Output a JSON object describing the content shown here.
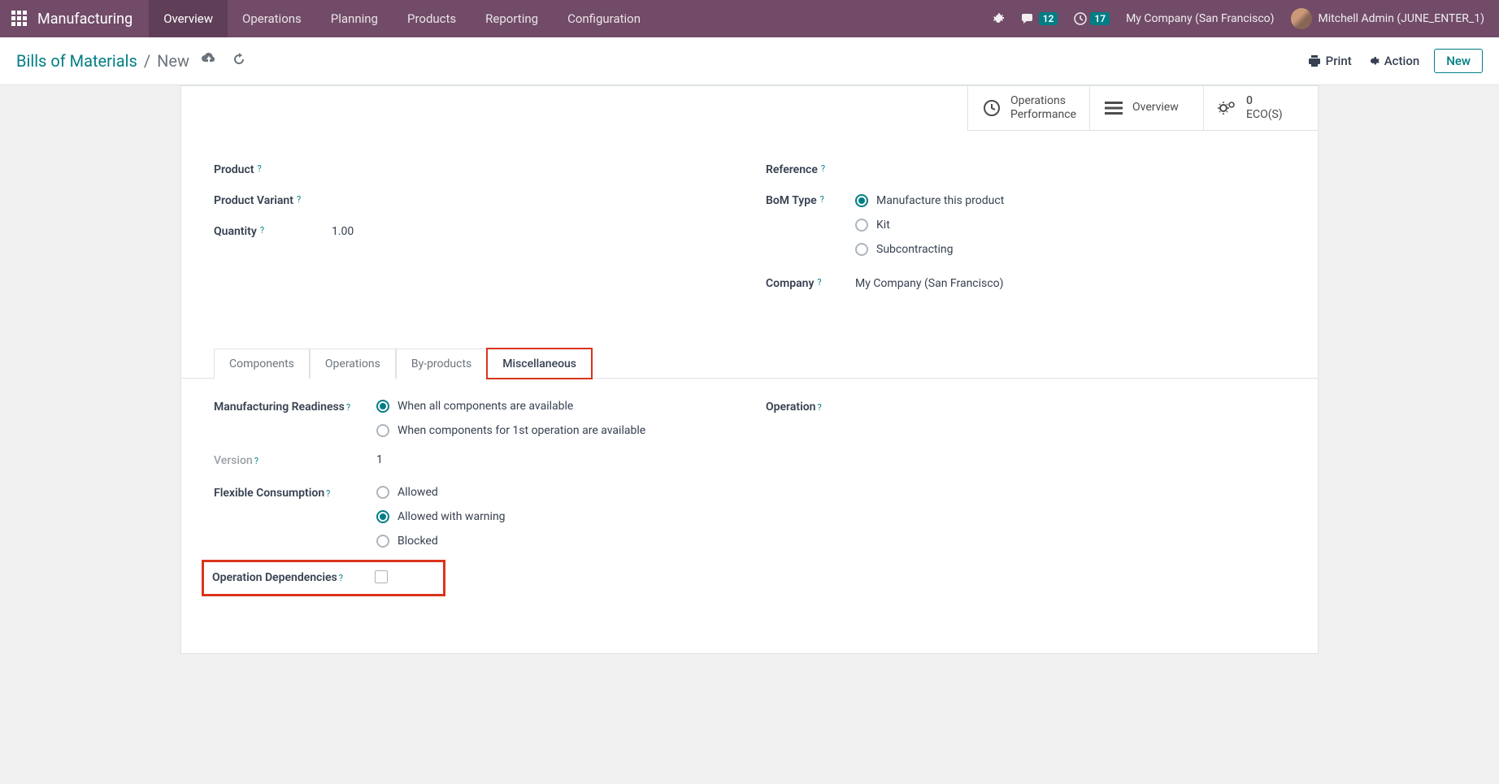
{
  "topnav": {
    "brand": "Manufacturing",
    "menu": [
      "Overview",
      "Operations",
      "Planning",
      "Products",
      "Reporting",
      "Configuration"
    ],
    "active_menu_index": 0,
    "chat_badge": "12",
    "clock_badge": "17",
    "company": "My Company (San Francisco)",
    "user": "Mitchell Admin (JUNE_ENTER_1)"
  },
  "controlbar": {
    "breadcrumb_root": "Bills of Materials",
    "breadcrumb_current": "New",
    "print": "Print",
    "action": "Action",
    "new": "New"
  },
  "statbuttons": {
    "ops_perf_l1": "Operations",
    "ops_perf_l2": "Performance",
    "overview": "Overview",
    "eco_count": "0",
    "eco_label": "ECO(S)"
  },
  "form": {
    "product_label": "Product",
    "product_variant_label": "Product Variant",
    "quantity_label": "Quantity",
    "quantity_value": "1.00",
    "reference_label": "Reference",
    "bom_type_label": "BoM Type",
    "bom_options": [
      "Manufacture this product",
      "Kit",
      "Subcontracting"
    ],
    "bom_selected_index": 0,
    "company_label": "Company",
    "company_value": "My Company (San Francisco)"
  },
  "tabs": [
    "Components",
    "Operations",
    "By-products",
    "Miscellaneous"
  ],
  "active_tab_index": 3,
  "misc": {
    "readiness_label": "Manufacturing Readiness",
    "readiness_options": [
      "When all components are available",
      "When components for 1st operation are available"
    ],
    "readiness_selected_index": 0,
    "version_label": "Version",
    "version_value": "1",
    "flex_label": "Flexible Consumption",
    "flex_options": [
      "Allowed",
      "Allowed with warning",
      "Blocked"
    ],
    "flex_selected_index": 1,
    "opdeps_label": "Operation Dependencies",
    "operation_label": "Operation"
  }
}
